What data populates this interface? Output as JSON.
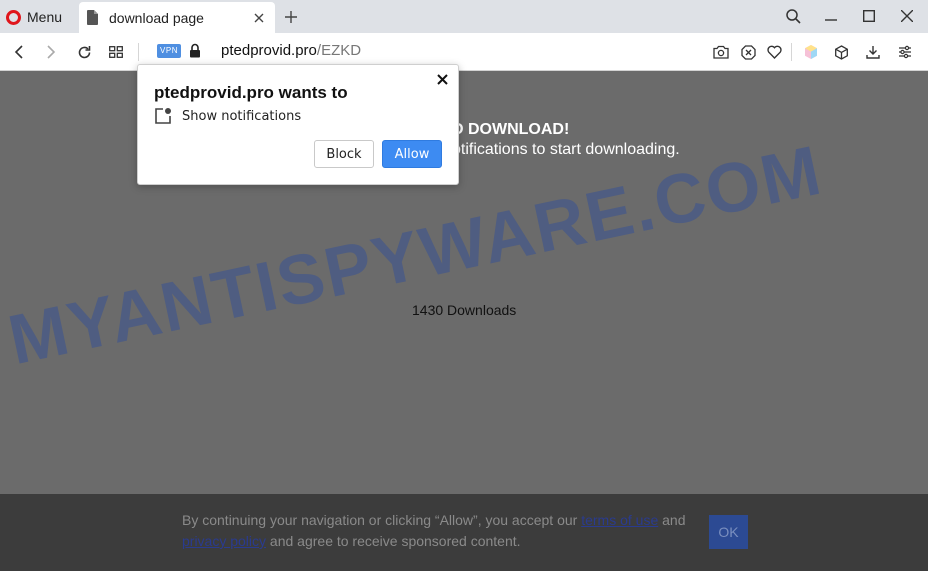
{
  "browser": {
    "menu_label": "Menu",
    "tab_title": "download page",
    "address": {
      "host": "ptedprovid.pro",
      "path": "/EZKD"
    },
    "vpn_badge": "VPN"
  },
  "page": {
    "headline": "D DOWNLOAD!",
    "subline": "otifications to start downloading.",
    "downloads_text": "1430 Downloads",
    "watermark": "MYANTISPYWARE.COM"
  },
  "footer": {
    "text_before": "By continuing your navigation or clicking “Allow”, you accept our ",
    "terms_link": "terms of use",
    "text_and": " and ",
    "privacy_link": "privacy policy",
    "text_after": " and agree to receive sponsored content.",
    "ok_label": "OK"
  },
  "prompt": {
    "title": "ptedprovid.pro wants to",
    "permission": "Show notifications",
    "block_label": "Block",
    "allow_label": "Allow"
  },
  "colors": {
    "allow_button": "#3d8bf2",
    "opera_red": "#e0161c",
    "page_overlay": "#6b6b6b",
    "footer_bg": "#3c3c3c"
  }
}
